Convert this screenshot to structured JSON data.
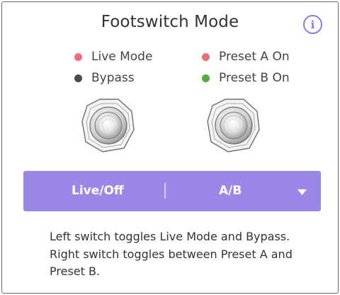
{
  "header": {
    "title": "Footswitch Mode",
    "info_icon": "info-icon",
    "info_glyph": "i"
  },
  "legend_left": [
    {
      "label": "Live Mode",
      "color": "#ee6e73"
    },
    {
      "label": "Bypass",
      "color": "#4a4a4a"
    }
  ],
  "legend_right": [
    {
      "label": "Preset A On",
      "color": "#ee6e73"
    },
    {
      "label": "Preset B On",
      "color": "#4caf3c"
    }
  ],
  "footswitches": [
    {
      "icon": "footswitch-icon"
    },
    {
      "icon": "footswitch-icon"
    }
  ],
  "mode_selector": {
    "left_label": "Live/Off",
    "right_label": "A/B",
    "caret_icon": "chevron-down-icon",
    "background": "#9c87e6"
  },
  "description": {
    "line1": "Left switch toggles Live Mode and Bypass.",
    "line2": "Right switch toggles between Preset A and",
    "line3": "Preset B."
  },
  "colors": {
    "accent": "#8e77ea",
    "text": "#333333"
  }
}
